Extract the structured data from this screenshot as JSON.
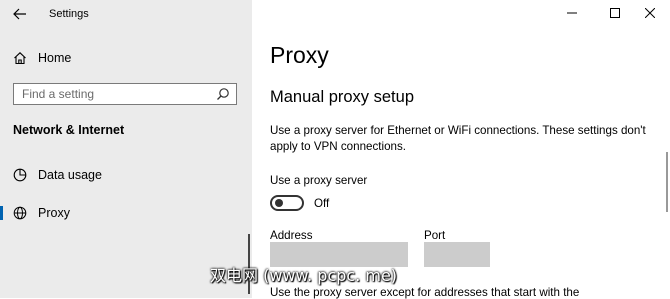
{
  "window": {
    "title": "Settings",
    "controls": [
      "minimize",
      "maximize",
      "close"
    ]
  },
  "sidebar": {
    "home_label": "Home",
    "search_placeholder": "Find a setting",
    "section_title": "Network & Internet",
    "items": [
      {
        "label": "Data usage",
        "icon": "data-usage-icon"
      },
      {
        "label": "Proxy",
        "icon": "globe-icon",
        "active": true
      }
    ]
  },
  "main": {
    "title": "Proxy",
    "subtitle": "Manual proxy setup",
    "description": "Use a proxy server for Ethernet or WiFi connections. These settings don't apply to VPN connections.",
    "use_proxy_label": "Use a proxy server",
    "toggle_state": "Off",
    "address_label": "Address",
    "address_value": "",
    "port_label": "Port",
    "port_value": "",
    "bottom_text": "Use the proxy server except for addresses that start with the"
  },
  "watermark": "双电网 (www. pcpc. me)",
  "colors": {
    "sidebar_bg": "#ebebeb",
    "accent": "#0063b1",
    "field_bg": "#cccccc"
  }
}
